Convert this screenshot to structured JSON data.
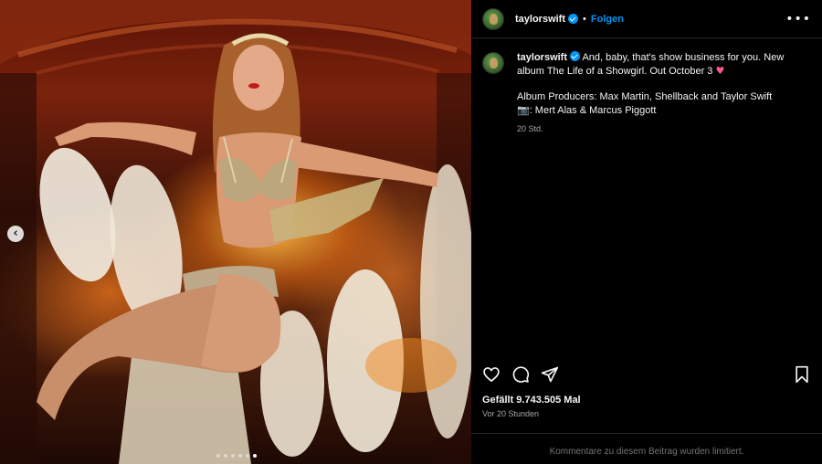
{
  "post": {
    "username": "taylorswift",
    "verified": true,
    "follow_label": "Folgen",
    "separator": "•",
    "more_label": "•••",
    "caption_line1": "And, baby, that's show business for you. New album The Life of a Showgirl. Out October 3 ",
    "caption_emoji": "♥",
    "caption_producers": "Album Producers: Max Martin, Shellback and Taylor Swift",
    "caption_credits": "📷: Mert Alas & Marcus Piggott",
    "caption_time": "20 Std.",
    "likes": "Gefällt 9.743.505 Mal",
    "date": "Vor 20 Stunden",
    "comments_limited": "Kommentare zu diesem Beitrag wurden limitiert."
  },
  "media": {
    "prev_label": "‹",
    "carousel_total": 6,
    "carousel_active": 6
  },
  "icons": {
    "like": "heart-icon",
    "comment": "comment-icon",
    "share": "share-icon",
    "save": "bookmark-icon",
    "verified": "verified-badge-icon",
    "more": "more-options-icon"
  },
  "colors": {
    "accent": "#0095f6",
    "background": "#000000",
    "secondary_text": "#a8a8a8",
    "muted_text": "#737373"
  }
}
